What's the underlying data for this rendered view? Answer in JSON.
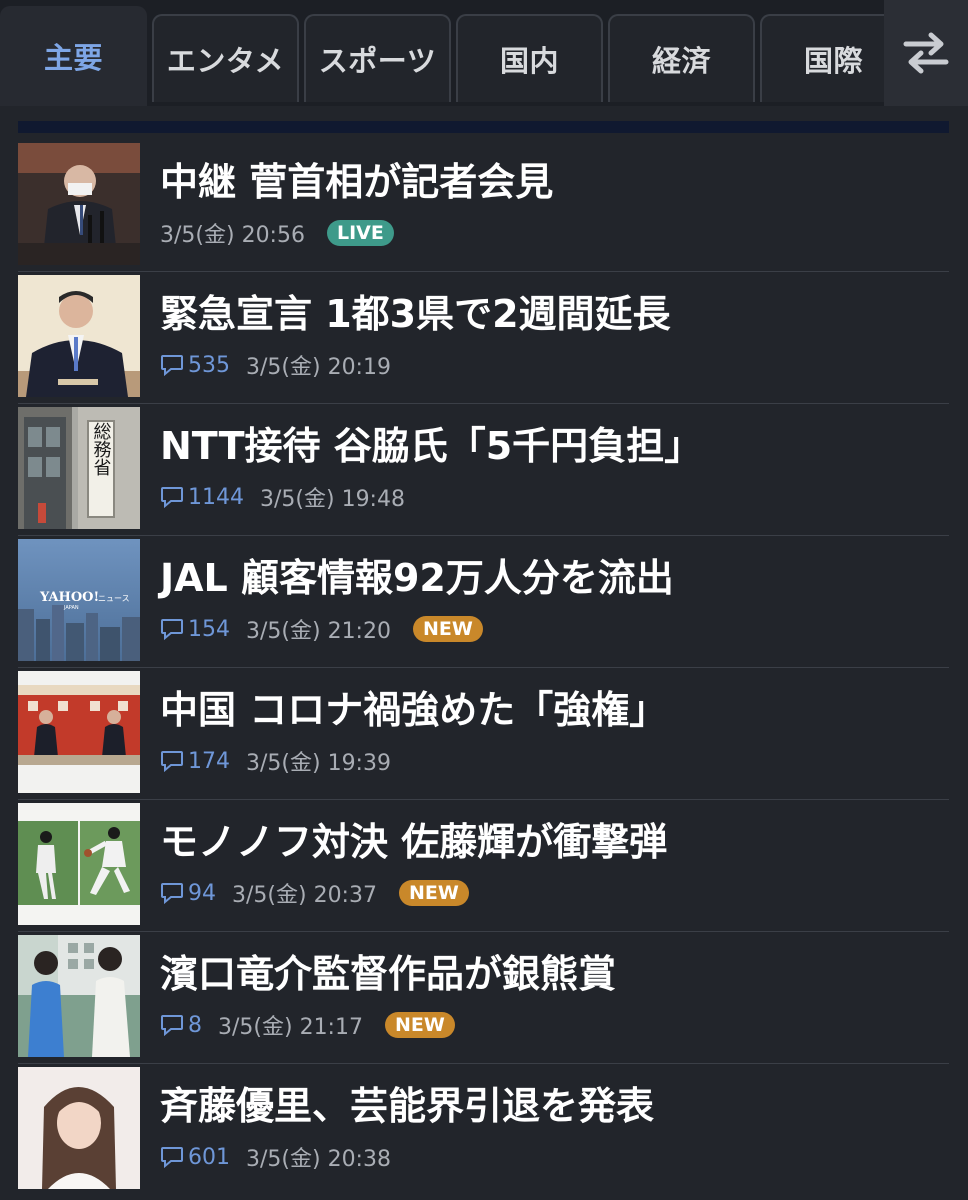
{
  "tabs": [
    {
      "label": "主要",
      "active": true
    },
    {
      "label": "エンタメ",
      "active": false
    },
    {
      "label": "スポーツ",
      "active": false
    },
    {
      "label": "国内",
      "active": false
    },
    {
      "label": "経済",
      "active": false
    },
    {
      "label": "国際",
      "active": false
    }
  ],
  "swap_icon": "swap-arrows-icon",
  "colors": {
    "background": "#22252b",
    "active_tab_text": "#7ea6e6",
    "comment_link": "#6f97d8",
    "live_badge": "#3e9a8a",
    "new_badge": "#c9882a"
  },
  "articles": [
    {
      "title": "中継 菅首相が記者会見",
      "comments": "",
      "time": "3/5(金) 20:56",
      "badge": "LIVE",
      "badge_type": "live"
    },
    {
      "title": "緊急宣言 1都3県で2週間延長",
      "comments": "535",
      "time": "3/5(金) 20:19",
      "badge": "",
      "badge_type": ""
    },
    {
      "title": "NTT接待 谷脇氏「5千円負担」",
      "comments": "1144",
      "time": "3/5(金) 19:48",
      "badge": "",
      "badge_type": ""
    },
    {
      "title": "JAL 顧客情報92万人分を流出",
      "comments": "154",
      "time": "3/5(金) 21:20",
      "badge": "NEW",
      "badge_type": "new"
    },
    {
      "title": "中国 コロナ禍強めた「強権」",
      "comments": "174",
      "time": "3/5(金) 19:39",
      "badge": "",
      "badge_type": ""
    },
    {
      "title": "モノノフ対決 佐藤輝が衝撃弾",
      "comments": "94",
      "time": "3/5(金) 20:37",
      "badge": "NEW",
      "badge_type": "new"
    },
    {
      "title": "濱口竜介監督作品が銀熊賞",
      "comments": "8",
      "time": "3/5(金) 21:17",
      "badge": "NEW",
      "badge_type": "new"
    },
    {
      "title": "斉藤優里、芸能界引退を発表",
      "comments": "601",
      "time": "3/5(金) 20:38",
      "badge": "",
      "badge_type": ""
    }
  ],
  "thumb_text": {
    "ministry_sign": "総務省",
    "yahoo_logo": "YAHOO!",
    "yahoo_sub": "ニュース",
    "yahoo_japan": "JAPAN"
  }
}
